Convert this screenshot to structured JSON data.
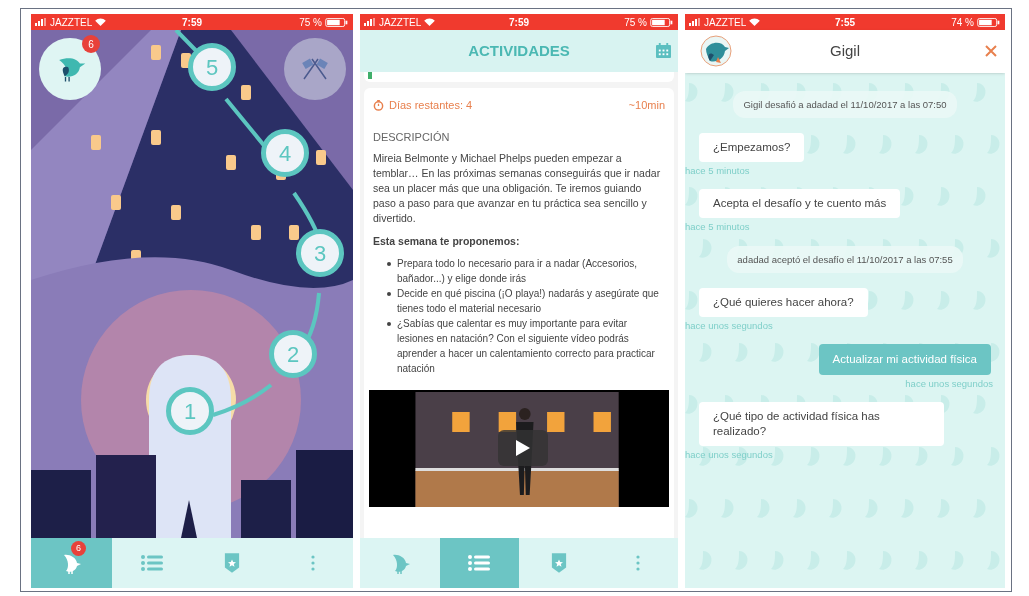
{
  "home_screen": {
    "status_bar": {
      "carrier": "JAZZTEL",
      "time": "7:59",
      "battery": "75 %"
    },
    "avatar_badge": "6",
    "steps": [
      "1",
      "2",
      "3",
      "4",
      "5"
    ],
    "tab_bar": [
      {
        "kind": "bird",
        "selected": true,
        "badge": "6"
      },
      {
        "kind": "list",
        "selected": false
      },
      {
        "kind": "shield",
        "selected": false
      },
      {
        "kind": "more",
        "selected": false
      }
    ]
  },
  "activities_screen": {
    "status_bar": {
      "carrier": "JAZZTEL",
      "time": "7:59",
      "battery": "75 %"
    },
    "title": "ACTIVIDADES",
    "days_remaining": "Días restantes: 4",
    "duration": "~10min",
    "section_title": "DESCRIPCIÓN",
    "description": "Mireia Belmonte y Michael Phelps pueden empezar a temblar… En las próximas semanas conseguirás que ir nadar sea un placer más que una obligación. Te iremos guiando paso a paso para que avanzar en tu práctica sea sencillo y divertido.",
    "subheading": "Esta semana te proponemos:",
    "bullets": [
      "Prepara todo lo necesario para ir a nadar (Accesorios, bañador...) y elige donde irás",
      "Decide en qué piscina (¡O playa!) nadarás y asegúrate que tienes todo el material necesario",
      "¿Sabías que calentar es muy importante para evitar lesiones en natación? Con el siguiente vídeo podrás aprender a hacer un calentamiento correcto para practicar natación"
    ],
    "tab_bar": [
      {
        "kind": "bird",
        "selected": false
      },
      {
        "kind": "list",
        "selected": true
      },
      {
        "kind": "shield",
        "selected": false
      },
      {
        "kind": "more",
        "selected": false
      }
    ]
  },
  "chat_screen": {
    "status_bar": {
      "carrier": "JAZZTEL",
      "time": "7:55",
      "battery": "74 %"
    },
    "title": "Gigil",
    "messages": [
      {
        "kind": "system",
        "text": "Gigil desafió a adadad el 11/10/2017 a las 07:50"
      },
      {
        "kind": "bot",
        "text": "¿Empezamos?",
        "time": "hace 5 minutos"
      },
      {
        "kind": "bot",
        "text": "Acepta el desafío y te cuento más",
        "time": "hace 5 minutos"
      },
      {
        "kind": "system",
        "text": "adadad aceptó el desafío el 11/10/2017 a las 07:55"
      },
      {
        "kind": "bot",
        "text": "¿Qué quieres hacer ahora?",
        "time": "hace unos segundos"
      },
      {
        "kind": "user",
        "text": "Actualizar mi actividad física",
        "time": "hace unos segundos"
      },
      {
        "kind": "bot",
        "text": "¿Qué tipo de actividad física has realizado?",
        "time": "hace unos segundos"
      }
    ]
  }
}
